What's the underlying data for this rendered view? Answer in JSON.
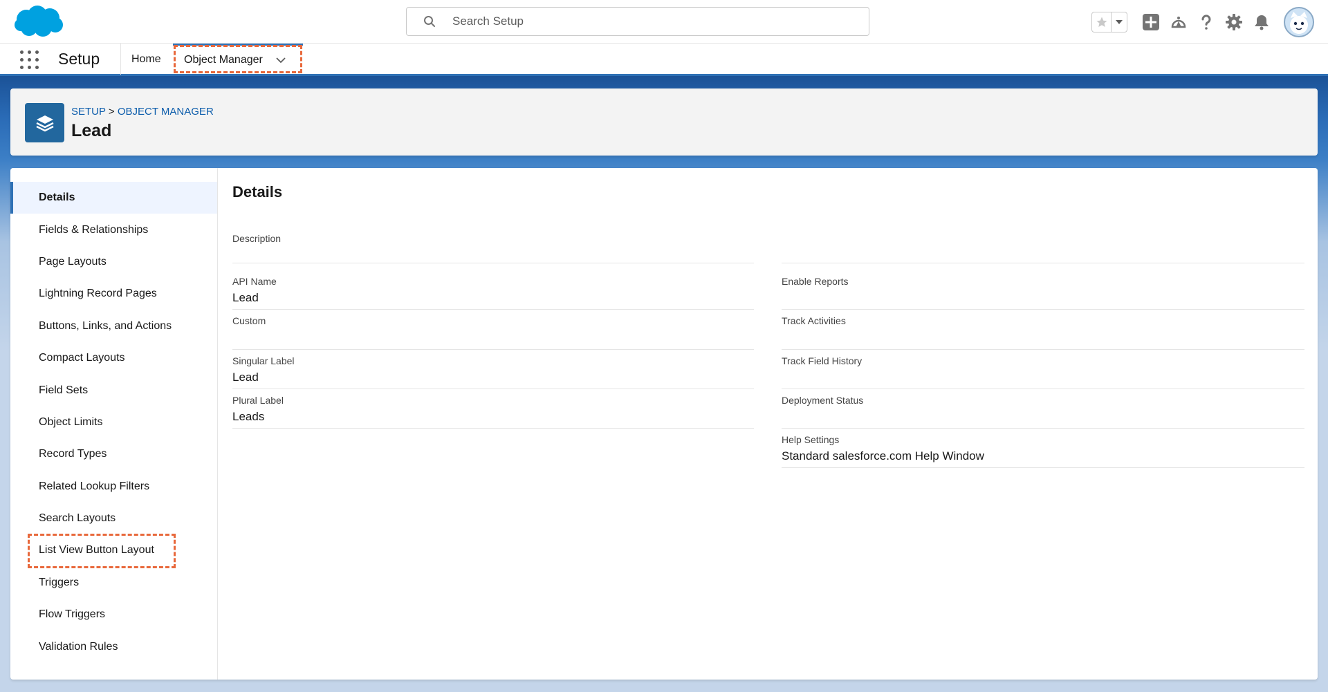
{
  "search": {
    "placeholder": "Search Setup"
  },
  "nav": {
    "app_name": "Setup",
    "home_label": "Home",
    "active_tab_label": "Object Manager"
  },
  "header": {
    "breadcrumb_root": "SETUP",
    "breadcrumb_sep": ">",
    "breadcrumb_current": "OBJECT MANAGER",
    "title": "Lead"
  },
  "sidebar": {
    "items": [
      {
        "label": "Details",
        "active": true
      },
      {
        "label": "Fields & Relationships"
      },
      {
        "label": "Page Layouts"
      },
      {
        "label": "Lightning Record Pages"
      },
      {
        "label": "Buttons, Links, and Actions"
      },
      {
        "label": "Compact Layouts"
      },
      {
        "label": "Field Sets"
      },
      {
        "label": "Object Limits"
      },
      {
        "label": "Record Types"
      },
      {
        "label": "Related Lookup Filters"
      },
      {
        "label": "Search Layouts"
      },
      {
        "label": "List View Button Layout"
      },
      {
        "label": "Triggers"
      },
      {
        "label": "Flow Triggers"
      },
      {
        "label": "Validation Rules"
      }
    ]
  },
  "details": {
    "title": "Details",
    "left": [
      {
        "label": "Description",
        "value": ""
      },
      {
        "label": "API Name",
        "value": "Lead"
      },
      {
        "label": "Custom",
        "value": ""
      },
      {
        "label": "Singular Label",
        "value": "Lead"
      },
      {
        "label": "Plural Label",
        "value": "Leads"
      }
    ],
    "right": [
      {
        "label": "Enable Reports",
        "value": ""
      },
      {
        "label": "Track Activities",
        "value": ""
      },
      {
        "label": "Track Field History",
        "value": ""
      },
      {
        "label": "Deployment Status",
        "value": ""
      },
      {
        "label": "Help Settings",
        "value": "Standard salesforce.com Help Window"
      }
    ]
  },
  "colors": {
    "brand_blue": "#2f71b5",
    "object_icon": "#22679e",
    "link": "#0b5cab",
    "highlight": "#e8683b"
  },
  "icons": {
    "logo": "salesforce-cloud-logo",
    "search": "search-icon",
    "favorites": "star-icon",
    "add": "plus-icon",
    "trailhead": "trailhead-icon",
    "help": "help-icon",
    "settings": "gear-icon",
    "notifications": "bell-icon",
    "object": "layers-icon"
  }
}
